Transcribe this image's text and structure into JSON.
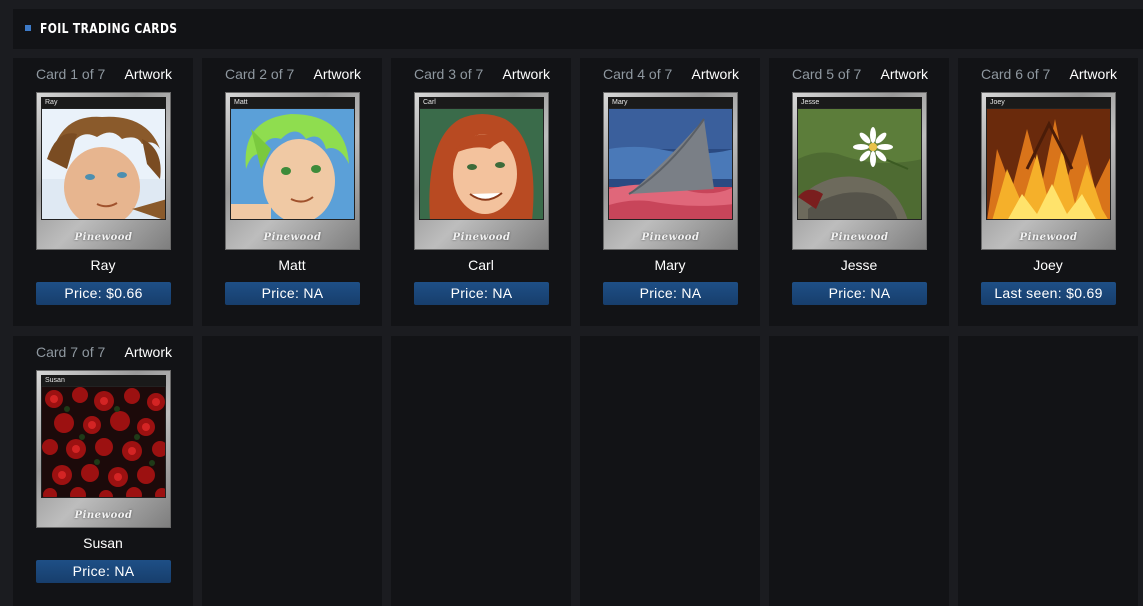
{
  "section": {
    "title": "FOIL TRADING CARDS"
  },
  "cards": [
    {
      "counter": "Card 1 of 7",
      "artwork_label": "Artwork",
      "card_title": "Ray",
      "name": "Ray",
      "price": "Price: $0.66",
      "logo": "Pinewood"
    },
    {
      "counter": "Card 2 of 7",
      "artwork_label": "Artwork",
      "card_title": "Matt",
      "name": "Matt",
      "price": "Price: NA",
      "logo": "Pinewood"
    },
    {
      "counter": "Card 3 of 7",
      "artwork_label": "Artwork",
      "card_title": "Carl",
      "name": "Carl",
      "price": "Price: NA",
      "logo": "Pinewood"
    },
    {
      "counter": "Card 4 of 7",
      "artwork_label": "Artwork",
      "card_title": "Mary",
      "name": "Mary",
      "price": "Price: NA",
      "logo": "Pinewood"
    },
    {
      "counter": "Card 5 of 7",
      "artwork_label": "Artwork",
      "card_title": "Jesse",
      "name": "Jesse",
      "price": "Price: NA",
      "logo": "Pinewood"
    },
    {
      "counter": "Card 6 of 7",
      "artwork_label": "Artwork",
      "card_title": "Joey",
      "name": "Joey",
      "price": "Last seen: $0.69",
      "logo": "Pinewood"
    },
    {
      "counter": "Card 7 of 7",
      "artwork_label": "Artwork",
      "card_title": "Susan",
      "name": "Susan",
      "price": "Price: NA",
      "logo": "Pinewood"
    }
  ]
}
